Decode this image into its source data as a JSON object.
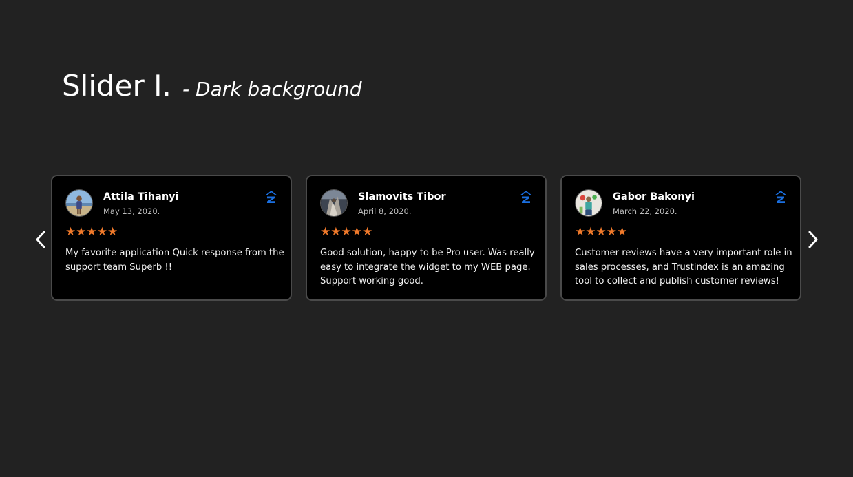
{
  "heading": {
    "main": "Slider I.",
    "sub": "- Dark background"
  },
  "colors": {
    "background": "#222222",
    "card_background": "#000000",
    "card_border": "#4a4a4a",
    "star": "#f17a2b",
    "platform_icon": "#1a6fe0"
  },
  "nav": {
    "prev_icon": "chevron-left-icon",
    "next_icon": "chevron-right-icon"
  },
  "reviews": [
    {
      "name": "Attila Tihanyi",
      "date": "May 13, 2020.",
      "rating": 5,
      "stars": "★★★★★",
      "text": "My favorite application Quick response from the support team Superb !!",
      "platform_icon": "zillow-icon"
    },
    {
      "name": "Slamovits Tibor",
      "date": "April 8, 2020.",
      "rating": 5,
      "stars": "★★★★★",
      "text": "Good solution, happy to be Pro user. Was really easy to integrate the widget to my WEB page. Support working good.",
      "platform_icon": "zillow-icon"
    },
    {
      "name": "Gabor Bakonyi",
      "date": "March 22, 2020.",
      "rating": 5,
      "stars": "★★★★★",
      "text": "Customer reviews have a very important role in sales processes, and Trustindex is an amazing tool to collect and publish customer reviews!",
      "platform_icon": "zillow-icon"
    }
  ]
}
